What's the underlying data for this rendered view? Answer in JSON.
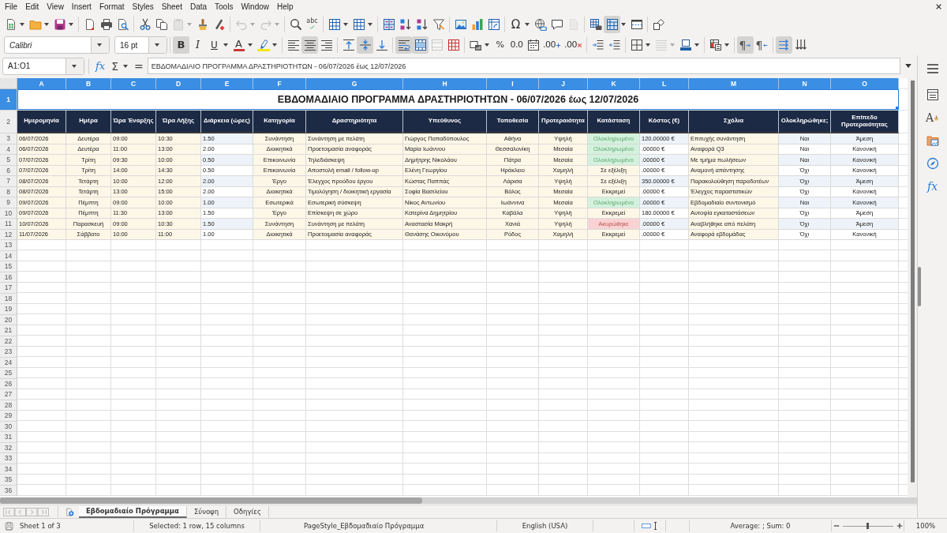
{
  "menu": [
    "File",
    "Edit",
    "View",
    "Insert",
    "Format",
    "Styles",
    "Sheet",
    "Data",
    "Tools",
    "Window",
    "Help"
  ],
  "standard_toolbar": [
    {
      "on": false,
      "disabled": false
    },
    {
      "on": false,
      "disabled": false
    },
    {
      "on": false,
      "disabled": false
    },
    {
      "on": false,
      "disabled": false
    },
    {
      "on": false,
      "disabled": false
    },
    {
      "on": false,
      "disabled": false
    },
    {
      "on": false,
      "disabled": false
    },
    {
      "on": false,
      "disabled": false
    },
    {
      "on": false,
      "disabled": true
    },
    {
      "on": false,
      "disabled": false
    },
    {
      "on": false,
      "disabled": false
    },
    {
      "on": false,
      "disabled": true
    },
    {
      "on": false,
      "disabled": true
    },
    {
      "on": false,
      "disabled": false
    },
    {
      "label": "abc",
      "on": false,
      "disabled": false
    },
    {
      "on": false,
      "disabled": false
    },
    {
      "on": false,
      "disabled": false
    },
    {
      "on": false,
      "disabled": false
    },
    {
      "on": false,
      "disabled": false
    },
    {
      "on": false,
      "disabled": false
    },
    {
      "on": false,
      "disabled": false
    },
    {
      "on": false,
      "disabled": false
    },
    {
      "on": false,
      "disabled": false
    },
    {
      "on": false,
      "disabled": false
    },
    {
      "label": "Ω",
      "on": false,
      "disabled": false
    },
    {
      "on": false,
      "disabled": false
    },
    {
      "on": false,
      "disabled": false
    },
    {
      "on": false,
      "disabled": true
    },
    {
      "on": false,
      "disabled": false
    },
    {
      "on": true,
      "disabled": false
    },
    {
      "on": false,
      "disabled": false
    },
    {
      "on": false,
      "disabled": false
    }
  ],
  "formatting_toolbar": {
    "font_name": "Calibri",
    "font_size": "16 pt",
    "buttons": [
      {
        "label": "B",
        "on": true,
        "disabled": false
      },
      {
        "label": "I",
        "on": false,
        "disabled": false
      },
      {
        "label": "U",
        "on": false,
        "disabled": false
      },
      {
        "label": "A",
        "on": false,
        "disabled": false
      },
      {
        "on": false,
        "disabled": false
      },
      {
        "on": false,
        "disabled": false
      },
      {
        "on": true,
        "disabled": false
      },
      {
        "on": false,
        "disabled": false
      },
      {
        "on": false,
        "disabled": false
      },
      {
        "on": true,
        "disabled": false
      },
      {
        "on": false,
        "disabled": false
      },
      {
        "on": true,
        "disabled": false
      },
      {
        "on": true,
        "disabled": false
      },
      {
        "on": false,
        "disabled": true
      },
      {
        "on": false,
        "disabled": false
      },
      {
        "on": false,
        "disabled": false
      },
      {
        "label": "%",
        "on": false,
        "disabled": false
      },
      {
        "label": "0.0",
        "on": false,
        "disabled": false
      },
      {
        "on": false,
        "disabled": false
      },
      {
        "label": ".00",
        "on": false,
        "disabled": false
      },
      {
        "label": ".00",
        "on": false,
        "disabled": false
      },
      {
        "on": false,
        "disabled": false
      },
      {
        "on": false,
        "disabled": false
      },
      {
        "on": false,
        "disabled": false
      },
      {
        "on": false,
        "disabled": true
      },
      {
        "on": false,
        "disabled": false
      },
      {
        "on": false,
        "disabled": false
      },
      {
        "label": "¶",
        "on": true,
        "disabled": false
      },
      {
        "label": "¶",
        "on": false,
        "disabled": false
      },
      {
        "on": true,
        "disabled": false
      },
      {
        "on": false,
        "disabled": false
      }
    ]
  },
  "formula_bar": {
    "name_box": "A1:O1",
    "buttons": [
      {
        "label": "fx"
      },
      {
        "label": "Σ"
      },
      {
        "label": "="
      }
    ],
    "formula": "ΕΒΔΟΜΑΔΙΑΙΟ ΠΡΟΓΡΑΜΜΑ ΔΡΑΣΤΗΡΙΟΤΗΤΩΝ - 06/07/2026 έως 12/07/2026"
  },
  "sidebar": {
    "styles_label": "A",
    "functions_label": "fx"
  },
  "sheet": {
    "columns": [
      {
        "letter": "A",
        "selected": true
      },
      {
        "letter": "B",
        "selected": true
      },
      {
        "letter": "C",
        "selected": true
      },
      {
        "letter": "D",
        "selected": true
      },
      {
        "letter": "E",
        "selected": true
      },
      {
        "letter": "F",
        "selected": true
      },
      {
        "letter": "G",
        "selected": true
      },
      {
        "letter": "H",
        "selected": true
      },
      {
        "letter": "I",
        "selected": true
      },
      {
        "letter": "J",
        "selected": true
      },
      {
        "letter": "K",
        "selected": true
      },
      {
        "letter": "L",
        "selected": true
      },
      {
        "letter": "M",
        "selected": true
      },
      {
        "letter": "N",
        "selected": true
      },
      {
        "letter": "O",
        "selected": true
      }
    ],
    "title_row": {
      "number": "1",
      "selected": true,
      "title": "ΕΒΔΟΜΑΔΙΑΙΟ ΠΡΟΓΡΑΜΜΑ ΔΡΑΣΤΗΡΙΟΤΗΤΩΝ - 06/07/2026 έως 12/07/2026"
    },
    "header_row": {
      "number": "2",
      "selected": false,
      "cells": [
        "Ημερομηνία",
        "Ημέρα",
        "Ώρα Έναρξης",
        "Ώρα Λήξης",
        "Διάρκεια (ώρες)",
        "Κατηγορία",
        "Δραστηριότητα",
        "Υπεύθυνος",
        "Τοποθεσία",
        "Προτεραιότητα",
        "Κατάσταση",
        "Κόστος (€)",
        "Σχόλια",
        "Ολοκληρώθηκε;",
        "Επίπεδο Προτεραιότητας"
      ]
    },
    "rows": [
      {
        "number": "3",
        "selected": false,
        "status": {
          "color": "#d3f1dc"
        },
        "cells": [
          "06/07/2026",
          "Δευτέρα",
          "09:00",
          "10:30",
          "1.50",
          "Συνάντηση",
          "Συνάντηση με πελάτη",
          "Γιώργος Παπαδόπουλος",
          "Αθήνα",
          "Υψηλή",
          "Ολοκληρωμένο",
          "120.00000 €",
          "Επιτυχής συνάντηση",
          "Ναι",
          "Άμεση"
        ]
      },
      {
        "number": "4",
        "selected": false,
        "status": {
          "color": "#d3f1dc"
        },
        "cells": [
          "06/07/2026",
          "Δευτέρα",
          "11:00",
          "13:00",
          "2.00",
          "Διοικητικά",
          "Προετοιμασία αναφοράς",
          "Μαρία Ιωάννου",
          "Θεσσαλονίκη",
          "Μεσαία",
          "Ολοκληρωμένο",
          ".00000 €",
          "Αναφορά Q3",
          "Ναι",
          "Κανονική"
        ]
      },
      {
        "number": "5",
        "selected": false,
        "status": {
          "color": "#d3f1dc"
        },
        "cells": [
          "07/07/2026",
          "Τρίτη",
          "09:30",
          "10:00",
          "0.50",
          "Επικοινωνία",
          "Τηλεδιάσκεψη",
          "Δημήτρης Νικολάου",
          "Πάτρα",
          "Μεσαία",
          "Ολοκληρωμένο",
          ".00000 €",
          "Με τμήμα πωλήσεων",
          "Ναι",
          "Κανονική"
        ]
      },
      {
        "number": "6",
        "selected": false,
        "cells": [
          "07/07/2026",
          "Τρίτη",
          "14:00",
          "14:30",
          "0.50",
          "Επικοινωνία",
          "Αποστολή email / follow-up",
          "Ελένη Γεωργίου",
          "Ηράκλειο",
          "Χαμηλή",
          "Σε εξέλιξη",
          ".00000 €",
          "Αναμονή απάντησης",
          "Όχι",
          "Κανονική"
        ]
      },
      {
        "number": "7",
        "selected": false,
        "cells": [
          "08/07/2026",
          "Τετάρτη",
          "10:00",
          "12:00",
          "2.00",
          "Έργο",
          "Έλεγχος προόδου έργου",
          "Κώστας Παππάς",
          "Λάρισα",
          "Υψηλή",
          "Σε εξέλιξη",
          "350.00000 €",
          "Παρακολούθηση παραδοτέων",
          "Όχι",
          "Άμεση"
        ]
      },
      {
        "number": "8",
        "selected": false,
        "cells": [
          "08/07/2026",
          "Τετάρτη",
          "13:00",
          "15:00",
          "2.00",
          "Διοικητικά",
          "Τιμολόγηση / διοικητική εργασία",
          "Σοφία Βασιλείου",
          "Βόλος",
          "Μεσαία",
          "Εκκρεμεί",
          ".00000 €",
          "Έλεγχος παραστατικών",
          "Όχι",
          "Κανονική"
        ]
      },
      {
        "number": "9",
        "selected": false,
        "status": {
          "color": "#d3f1dc"
        },
        "cells": [
          "09/07/2026",
          "Πέμπτη",
          "09:00",
          "10:00",
          "1.00",
          "Εσωτερικά",
          "Εσωτερική σύσκεψη",
          "Νίκος Αντωνίου",
          "Ιωάννινα",
          "Μεσαία",
          "Ολοκληρωμένο",
          ".00000 €",
          "Εβδομαδιαίο συντονισμό",
          "Ναι",
          "Κανονική"
        ]
      },
      {
        "number": "10",
        "selected": false,
        "cells": [
          "09/07/2026",
          "Πέμπτη",
          "11:30",
          "13:00",
          "1.50",
          "Έργο",
          "Επίσκεψη σε χώρο",
          "Κατερίνα Δημητρίου",
          "Καβάλα",
          "Υψηλή",
          "Εκκρεμεί",
          "180.00000 €",
          "Αυτοψία εγκαταστάσεων",
          "Όχι",
          "Άμεση"
        ]
      },
      {
        "number": "11",
        "selected": false,
        "status": {
          "color": "#f9d3d3"
        },
        "cells": [
          "10/07/2026",
          "Παρασκευή",
          "09:00",
          "10:30",
          "1.50",
          "Συνάντηση",
          "Συνάντηση με πελάτη",
          "Αναστασία Μακρή",
          "Χανιά",
          "Υψηλή",
          "Ακυρώθηκε",
          ".00000 €",
          "Αναβλήθηκε από πελάτη",
          "Όχι",
          "Άμεση"
        ]
      },
      {
        "number": "12",
        "selected": false,
        "cells": [
          "11/07/2026",
          "Σάββατο",
          "10:00",
          "11:00",
          "1.00",
          "Διοικητικά",
          "Προετοιμασία αναφοράς",
          "Θανάσης Οικονόμου",
          "Ρόδος",
          "Χαμηλή",
          "Εκκρεμεί",
          ".00000 €",
          "Αναφορά εβδομάδας",
          "Όχι",
          "Κανονική"
        ]
      }
    ],
    "empty_rows": [
      {
        "number": "13",
        "selected": false
      },
      {
        "number": "14",
        "selected": false
      },
      {
        "number": "15",
        "selected": false
      },
      {
        "number": "16",
        "selected": false
      },
      {
        "number": "17",
        "selected": false
      },
      {
        "number": "18",
        "selected": false
      },
      {
        "number": "19",
        "selected": false
      },
      {
        "number": "20",
        "selected": false
      },
      {
        "number": "21",
        "selected": false
      },
      {
        "number": "22",
        "selected": false
      },
      {
        "number": "23",
        "selected": false
      },
      {
        "number": "24",
        "selected": false
      },
      {
        "number": "25",
        "selected": false
      },
      {
        "number": "26",
        "selected": false
      },
      {
        "number": "27",
        "selected": false
      },
      {
        "number": "28",
        "selected": false
      },
      {
        "number": "29",
        "selected": false
      },
      {
        "number": "30",
        "selected": false
      },
      {
        "number": "31",
        "selected": false
      },
      {
        "number": "32",
        "selected": false
      },
      {
        "number": "33",
        "selected": false
      },
      {
        "number": "34",
        "selected": false
      },
      {
        "number": "35",
        "selected": false
      },
      {
        "number": "36",
        "selected": false
      }
    ]
  },
  "sheet_tabs": [
    {
      "label": "Εβδομαδιαίο Πρόγραμμα",
      "selected": true
    },
    {
      "label": "Σύνοψη",
      "selected": false
    },
    {
      "label": "Οδηγίες",
      "selected": false
    }
  ],
  "status_bar": {
    "sheet_position": "Sheet 1 of 3",
    "selection": "Selected: 1 row, 15 columns",
    "page_style": "PageStyle_Εβδομαδιαίο Πρόγραμμα",
    "language": "English (USA)",
    "summary": "Average: ; Sum: 0",
    "zoom": {
      "level": 0.5,
      "value": "100%"
    }
  }
}
